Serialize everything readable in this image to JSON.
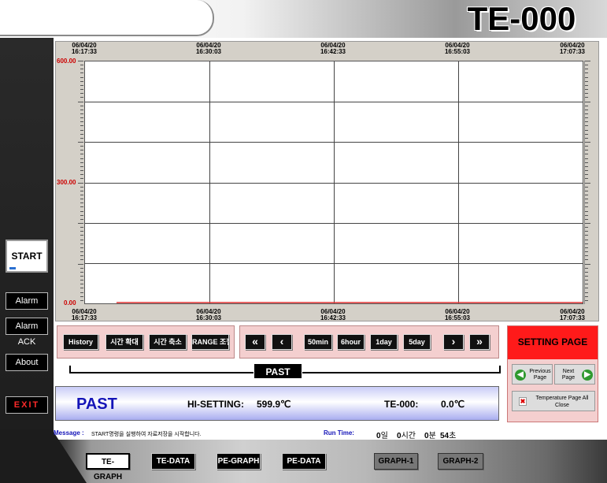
{
  "app_title": "TE-000",
  "sidebar": {
    "start": "START",
    "alarm": "Alarm",
    "alarm_ack": "Alarm ACK",
    "about": "About",
    "exit": "EXIT"
  },
  "graph": {
    "top_times": [
      [
        "06/04/20",
        "16:17:33"
      ],
      [
        "06/04/20",
        "16:30:03"
      ],
      [
        "06/04/20",
        "16:42:33"
      ],
      [
        "06/04/20",
        "16:55:03"
      ],
      [
        "06/04/20",
        "17:07:33"
      ]
    ],
    "bottom_times": [
      [
        "06/04/20",
        "16:17:33"
      ],
      [
        "06/04/20",
        "16:30:03"
      ],
      [
        "06/04/20",
        "16:42:33"
      ],
      [
        "06/04/20",
        "16:55:03"
      ],
      [
        "06/04/20",
        "17:07:33"
      ]
    ],
    "y_labels": [
      "600.00",
      "300.00",
      "0.00"
    ],
    "line_color": "#e03030"
  },
  "chart_data": {
    "type": "line",
    "x": [
      "06/04/20 16:17:33",
      "06/04/20 17:07:33"
    ],
    "series": [
      {
        "values": [
          0.0,
          0.0
        ]
      }
    ],
    "ylim": [
      0,
      600
    ],
    "yticks": [
      "0.00",
      "300.00",
      "600.00"
    ],
    "grid": true
  },
  "controls": {
    "left_group": [
      "History",
      "시간 확대",
      "시간 축소",
      "RANGE 조절"
    ],
    "nav_group": [
      "«",
      "‹",
      "50min",
      "6hour",
      "1day",
      "5day",
      "›",
      "»"
    ]
  },
  "past_label": "PAST",
  "status": {
    "mode": "PAST",
    "hi_setting_label": "HI-SETTING:",
    "hi_setting_value": "599.9℃",
    "sensor_label": "TE-000:",
    "sensor_value": "0.0℃"
  },
  "setting": {
    "title": "SETTING PAGE",
    "prev_label": "Previous Page",
    "next_label": "Next Page",
    "close_all_label": "Temperature Page All Close"
  },
  "message": {
    "prefix": "Message :",
    "text": "START명령을 실행하여 자료저장을 시작합니다."
  },
  "runtime": {
    "label": "Run Time:",
    "days": "0",
    "days_unit": "일",
    "hours": "0",
    "hours_unit": "시간",
    "minutes": "0",
    "minutes_unit": "분",
    "seconds": "54",
    "seconds_unit": "초"
  },
  "tabs": [
    "TE-GRAPH",
    "TE-DATA",
    "PE-GRAPH",
    "PE-DATA",
    "GRAPH-1",
    "GRAPH-2"
  ],
  "accent_colors": {
    "status_text": "#1414b8",
    "setting_bg": "#ff1a1a",
    "exit_text": "#ff2a2a"
  }
}
